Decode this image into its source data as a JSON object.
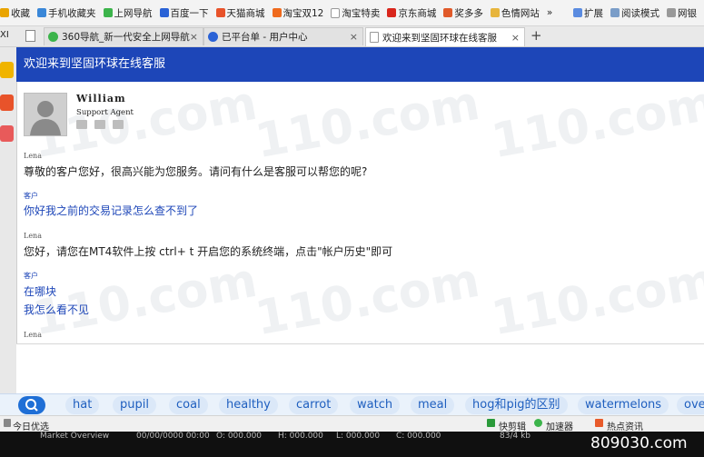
{
  "bookmarks": {
    "items": [
      {
        "label": "收藏",
        "color": "#e9a400"
      },
      {
        "label": "手机收藏夹",
        "color": "#3a87d8"
      },
      {
        "label": "上网导航",
        "color": "#3cb44b"
      },
      {
        "label": "百度一下",
        "color": "#2a62d6"
      },
      {
        "label": "天猫商城",
        "color": "#e8532a"
      },
      {
        "label": "淘宝双12",
        "color": "#ef6a1d"
      },
      {
        "label": "淘宝特卖",
        "color": "#999999"
      },
      {
        "label": "京东商城",
        "color": "#d9261c"
      },
      {
        "label": "奖多多",
        "color": "#e05a2a"
      },
      {
        "label": "色情网站",
        "color": "#e7b53c"
      }
    ],
    "more": "»",
    "right": [
      "扩展",
      "阅读模式",
      "网银"
    ]
  },
  "tabs": [
    {
      "label": "360导航_新一代安全上网导航",
      "close": "×"
    },
    {
      "label": "已平台单 - 用户中心",
      "close": "×"
    },
    {
      "label": "欢迎来到坚固环球在线客服",
      "close": "×"
    }
  ],
  "new_tab": "+",
  "tab_partial": "XI",
  "chat": {
    "header": "欢迎来到坚固环球在线客服",
    "agent": {
      "name": "William",
      "role": "Support Agent"
    },
    "messages": [
      {
        "sender": "Lena",
        "text": "尊敬的客户您好，很高兴能为您服务。请问有什么是客服可以帮您的呢?"
      },
      {
        "sender": "客户",
        "text": "你好我之前的交易记录怎么查不到了"
      },
      {
        "sender": "Lena",
        "text": "您好，请您在MT4软件上按 ctrl+ t 开启您的系统终端，点击\"帐户历史\"即可"
      },
      {
        "sender": "客户",
        "lines": [
          "在哪块",
          "我怎么看不见"
        ]
      },
      {
        "sender": "Lena",
        "text": ""
      }
    ]
  },
  "suggestions": [
    "hat",
    "pupil",
    "coal",
    "healthy",
    "carrot",
    "watch",
    "meal",
    "hog和pig的区别",
    "watermelons",
    "ove"
  ],
  "status": {
    "left": "今日优选",
    "right": [
      "快剪辑",
      "加速器",
      "热点资讯"
    ],
    "taskbar": [
      "Market Overview",
      "00/00/0000 00:00",
      "O: 000.000",
      "H: 000.000",
      "L: 000.000",
      "C: 000.000",
      "83/4 kb"
    ]
  },
  "watermark": "110.com",
  "watermark_corner": "809030.com"
}
